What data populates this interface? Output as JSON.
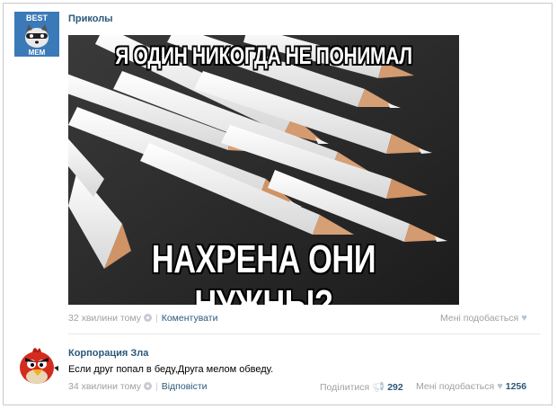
{
  "post1": {
    "author": "Приколы",
    "avatar_text_top": "BEST",
    "avatar_text_bottom": "MEM",
    "meme_top": "Я ОДИН НИКОГДА НЕ ПОНИМАЛ",
    "meme_bottom": "НАХРЕНА ОНИ НУЖНЫ?",
    "time": "32 хвилини тому",
    "comment_label": "Коментувати",
    "like_label": "Мені подобається"
  },
  "post2": {
    "author": "Корпорация Зла",
    "text": "Если друг попал в беду,Друга мелом обведу.",
    "time": "34 хвилини тому",
    "reply_label": "Відповісти",
    "share_label": "Поділитися",
    "share_count": "292",
    "like_label": "Мені подобається",
    "like_count": "1256"
  },
  "colors": {
    "link": "#2b587a",
    "meta": "#a0a0a0",
    "bird_red": "#d52b1e"
  }
}
